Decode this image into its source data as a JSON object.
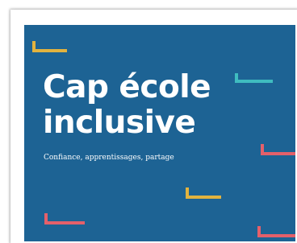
{
  "cover": {
    "title_line_1": "Cap école",
    "title_line_2": "inclusive",
    "subtitle": "Confiance, apprentissages, partage"
  },
  "colors": {
    "background": "#1d6394",
    "title_text": "#ffffff",
    "accent_yellow": "#e2b33f",
    "accent_teal": "#3fbcc0",
    "accent_red": "#e4606a"
  }
}
